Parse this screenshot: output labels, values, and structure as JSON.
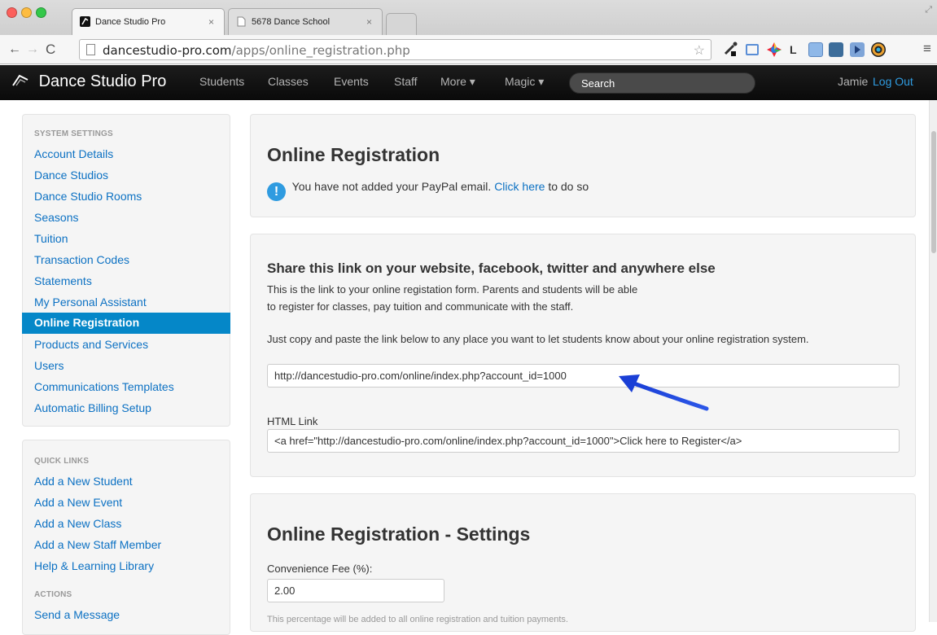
{
  "browser": {
    "tabs": [
      {
        "title": "Dance Studio Pro"
      },
      {
        "title": "5678 Dance School"
      }
    ],
    "url_host": "dancestudio-pro.com",
    "url_path": "/apps/online_registration.php"
  },
  "nav": {
    "brand": "Dance Studio Pro",
    "items": [
      "Students",
      "Classes",
      "Events",
      "Staff",
      "More ▾",
      "Magic ▾"
    ],
    "search_placeholder": "Search",
    "user_name": "Jamie",
    "logout": "Log Out"
  },
  "sidebar": {
    "system_header": "SYSTEM SETTINGS",
    "system_links": [
      "Account Details",
      "Dance Studios",
      "Dance Studio Rooms",
      "Seasons",
      "Tuition",
      "Transaction Codes",
      "Statements",
      "My Personal Assistant",
      "Online Registration",
      "Products and Services",
      "Users",
      "Communications Templates",
      "Automatic Billing Setup"
    ],
    "quick_header": "QUICK LINKS",
    "quick_links": [
      "Add a New Student",
      "Add a New Event",
      "Add a New Class",
      "Add a New Staff Member",
      "Help & Learning Library"
    ],
    "actions_header": "ACTIONS",
    "action_links": [
      "Send a Message"
    ]
  },
  "main": {
    "title": "Online Registration",
    "alert_text": "You have not added your PayPal email.",
    "alert_link": "Click here",
    "alert_suffix": "to do so",
    "share_heading": "Share this link on your website, facebook, twitter and anywhere else",
    "share_line1": "This is the link to your online registation form. Parents and students will be able",
    "share_line2": "to register for classes, pay tuition and communicate with the staff.",
    "copy_text": "Just copy and paste the link below to any place you want to let students know about your online registration system.",
    "link_value": "http://dancestudio-pro.com/online/index.php?account_id=1000",
    "html_link_label": "HTML Link",
    "html_link_value": "<a href=\"http://dancestudio-pro.com/online/index.php?account_id=1000\">Click here to Register</a>",
    "settings_title": "Online Registration - Settings",
    "fee_label": "Convenience Fee (%):",
    "fee_value": "2.00",
    "fee_help": "This percentage will be added to all online registration and tuition payments."
  },
  "colors": {
    "accent": "#0587c8",
    "link": "#0c71c3",
    "navbar": "#111111",
    "arrow": "#1a3fd6"
  }
}
